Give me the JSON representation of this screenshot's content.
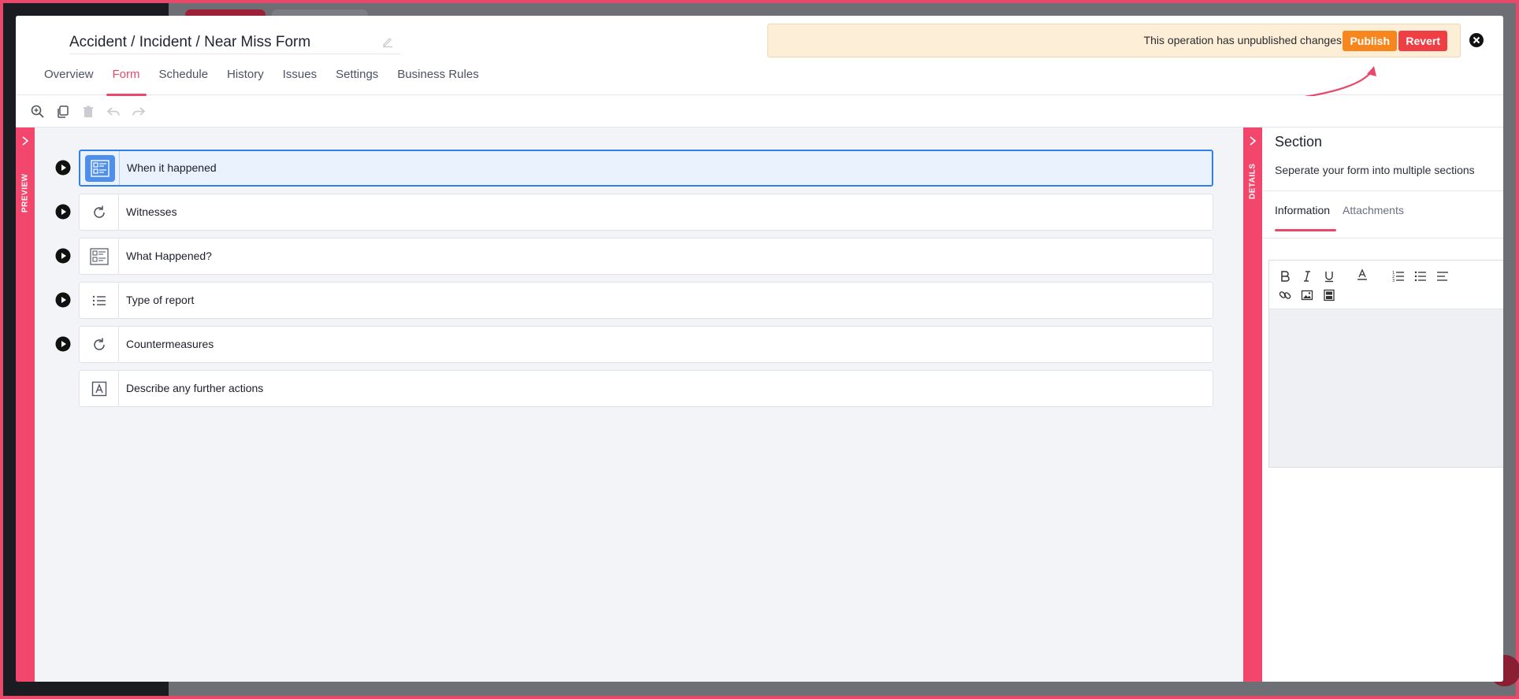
{
  "form": {
    "title": "Accident / Incident / Near Miss Form"
  },
  "tabs": [
    {
      "label": "Overview",
      "active": false
    },
    {
      "label": "Form",
      "active": true
    },
    {
      "label": "Schedule",
      "active": false
    },
    {
      "label": "History",
      "active": false
    },
    {
      "label": "Issues",
      "active": false
    },
    {
      "label": "Settings",
      "active": false
    },
    {
      "label": "Business Rules",
      "active": false
    }
  ],
  "banner": {
    "message": "This operation has unpublished changes",
    "publish_label": "Publish",
    "revert_label": "Revert"
  },
  "toolbar": {
    "icons": [
      "zoom-in-icon",
      "copy-icon",
      "trash-icon",
      "undo-icon",
      "redo-icon"
    ]
  },
  "preview": {
    "label": "PREVIEW"
  },
  "details": {
    "label": "DETAILS"
  },
  "rows": [
    {
      "label": "When it happened",
      "icon": "section-icon",
      "has_play": true,
      "selected": true
    },
    {
      "label": "Witnesses",
      "icon": "repeat-icon",
      "has_play": true,
      "selected": false
    },
    {
      "label": "What Happened?",
      "icon": "section-icon",
      "has_play": true,
      "selected": false
    },
    {
      "label": "Type of report",
      "icon": "list-icon",
      "has_play": true,
      "selected": false
    },
    {
      "label": "Countermeasures",
      "icon": "repeat-icon",
      "has_play": true,
      "selected": false
    },
    {
      "label": "Describe any further actions",
      "icon": "text-field-icon",
      "has_play": false,
      "selected": false
    }
  ],
  "panel": {
    "title": "Section",
    "description": "Seperate your form into multiple sections",
    "tabs": [
      {
        "label": "Information",
        "active": true
      },
      {
        "label": "Attachments",
        "active": false
      }
    ],
    "editor_tools": [
      "bold-icon",
      "italic-icon",
      "underline-icon",
      "text-color-icon",
      "ordered-list-icon",
      "bullet-list-icon",
      "align-icon",
      "link-icon",
      "image-icon",
      "video-icon"
    ]
  },
  "colors": {
    "accent": "#e8496b",
    "publish": "#f7861f",
    "revert": "#ef3e44",
    "selected_border": "#2f80ed",
    "banner_bg": "#fdefd7"
  }
}
